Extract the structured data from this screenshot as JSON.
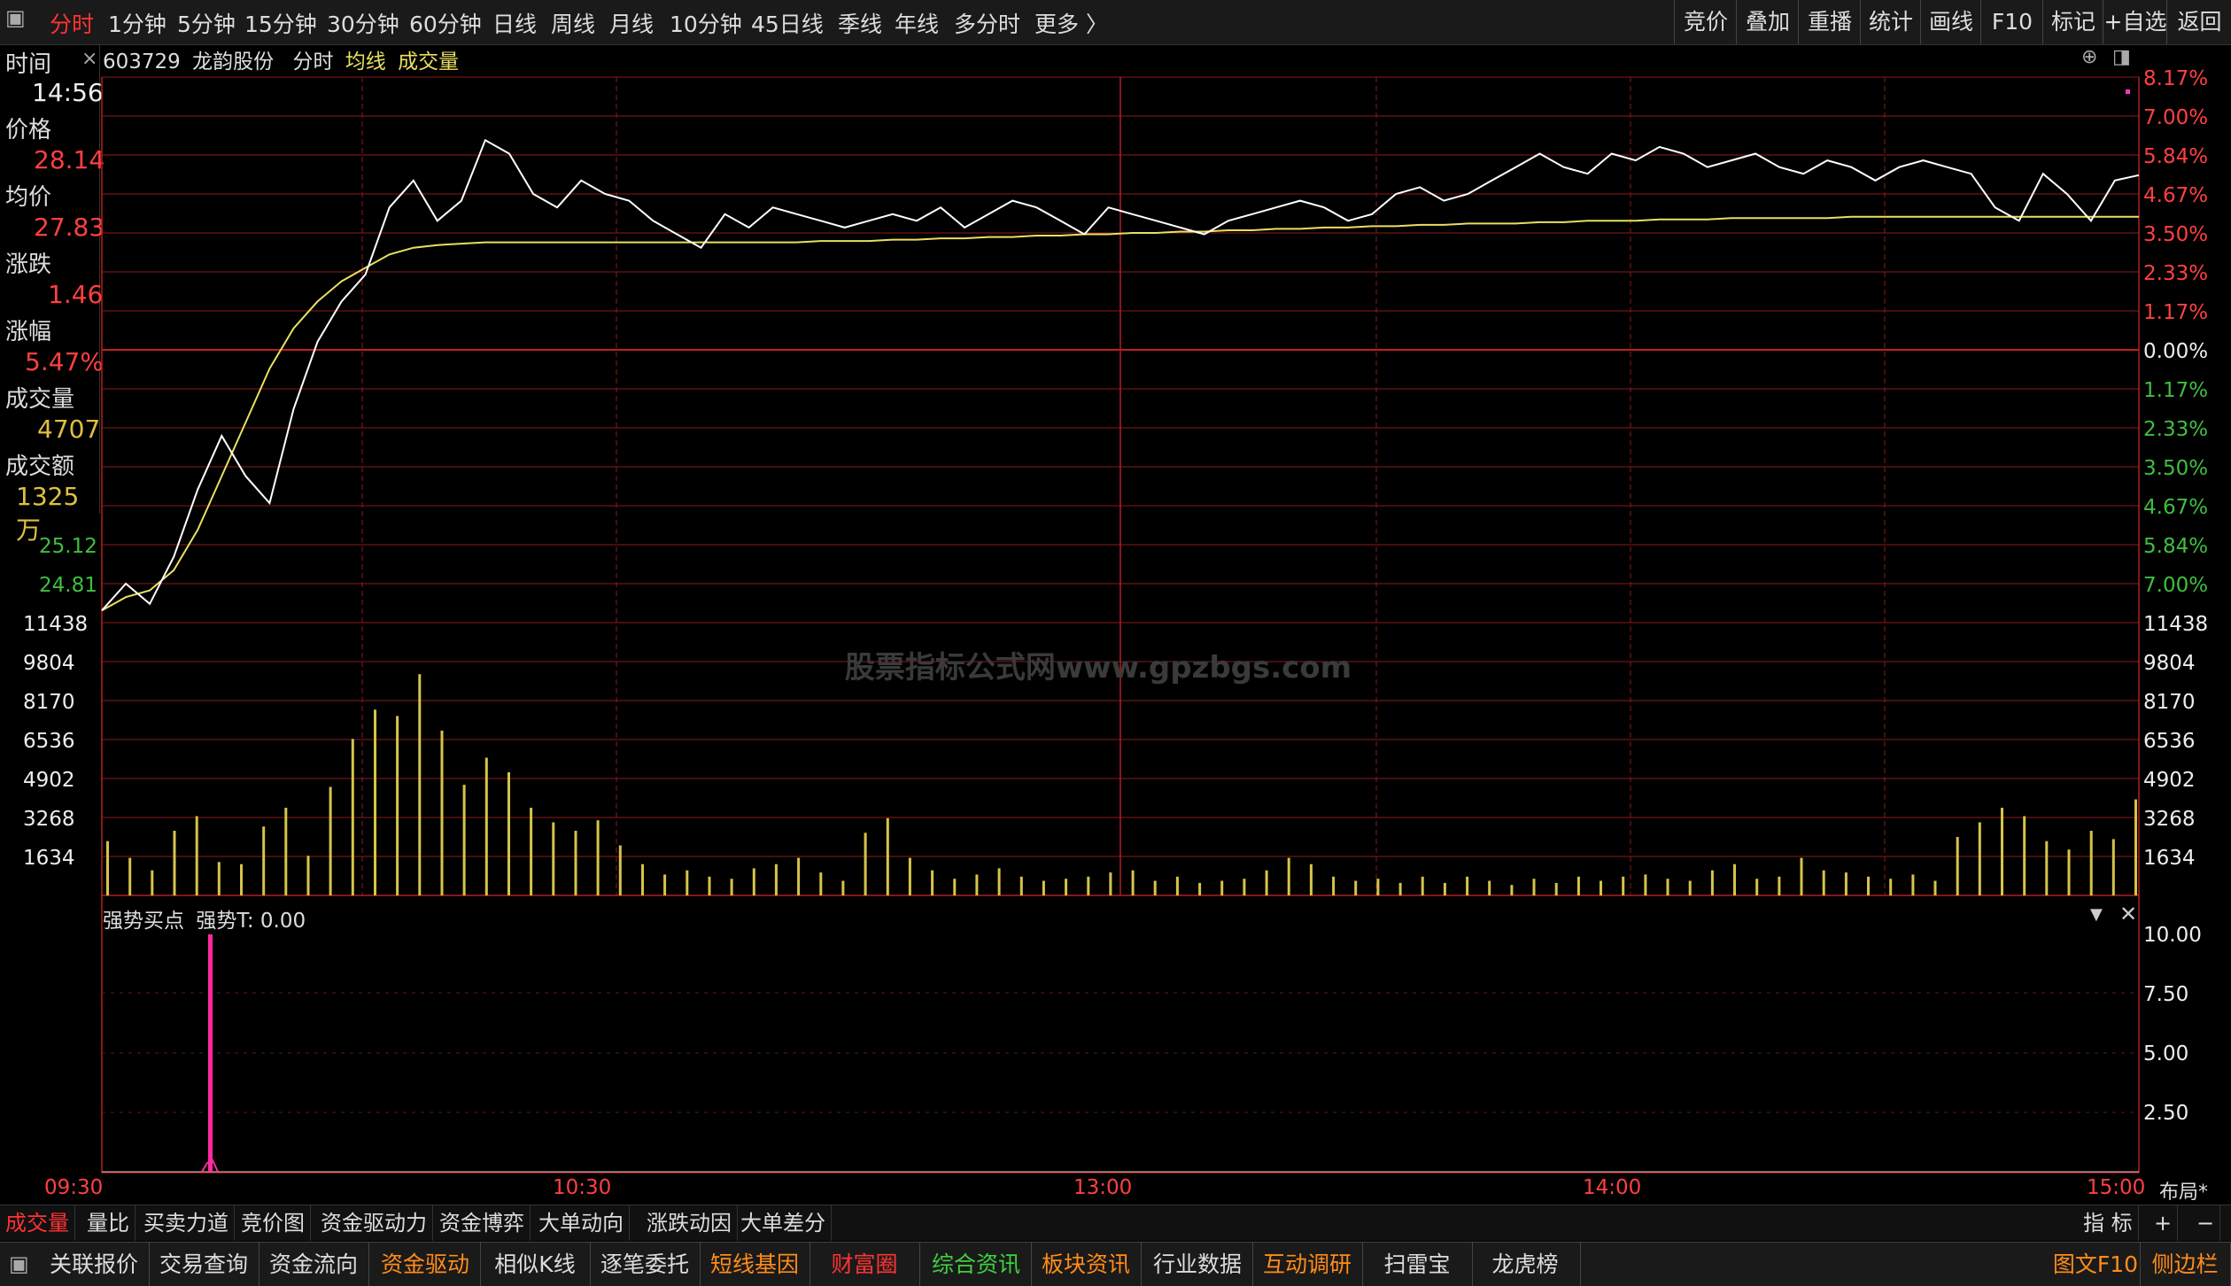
{
  "topbar": {
    "periods": [
      "分时",
      "1分钟",
      "5分钟",
      "15分钟",
      "30分钟",
      "60分钟",
      "日线",
      "周线",
      "月线",
      "10分钟",
      "45日线",
      "季线",
      "年线",
      "多分时",
      "更多 〉"
    ],
    "active_period": "分时",
    "right_buttons": [
      "竞价",
      "叠加",
      "重播",
      "统计",
      "画线",
      "F10",
      "标记",
      "+自选",
      "返回"
    ]
  },
  "chart_header": {
    "code": "603729",
    "name": "龙韵股份",
    "mode": "分时",
    "avg_label": "均线",
    "vol_label": "成交量"
  },
  "info_panel": {
    "time_label": "时间",
    "time_value": "14:56",
    "close_x": "×",
    "price_label": "价格",
    "price_value": "28.14",
    "avg_label": "均价",
    "avg_value": "27.83",
    "change_label": "涨跌",
    "change_value": "1.46",
    "pct_label": "涨幅",
    "pct_value": "5.47%",
    "vol_label": "成交量",
    "vol_value": "4707",
    "amount_label": "成交额",
    "amount_value": "1325万"
  },
  "price_axis_left": [
    "25.12",
    "24.81"
  ],
  "price_axis_right_up": [
    "8.17%",
    "7.00%",
    "5.84%",
    "4.67%",
    "3.50%",
    "2.33%",
    "1.17%",
    "0.00%"
  ],
  "price_axis_right_down": [
    "1.17%",
    "2.33%",
    "3.50%",
    "4.67%",
    "5.84%",
    "7.00%"
  ],
  "volume_axis": [
    "11438",
    "9804",
    "8170",
    "6536",
    "4902",
    "3268",
    "1634"
  ],
  "indicator": {
    "title": "强势买点",
    "value_label": "强势T: 0.00",
    "axis": [
      "10.00",
      "7.50",
      "5.00",
      "2.50"
    ]
  },
  "watermark": "股票指标公式网www.gpzbgs.com",
  "time_axis": [
    "09:30",
    "10:30",
    "13:00",
    "14:00",
    "15:00"
  ],
  "layout_btn": "布局*",
  "bottom_tabs": [
    "成交量",
    "量比",
    "买卖力道",
    "竞价图",
    "资金驱动力",
    "资金博弈",
    "大单动向",
    "涨跌动因",
    "大单差分"
  ],
  "bottom_tabs_right": [
    "指 标",
    "+",
    "−"
  ],
  "bottom_bar": [
    "关联报价",
    "交易查询",
    "资金流向",
    "资金驱动",
    "相似K线",
    "逐笔委托",
    "短线基因",
    "财富圈",
    "综合资讯",
    "板块资讯",
    "行业数据",
    "互动调研",
    "扫雷宝",
    "龙虎榜"
  ],
  "bottom_bar_right": [
    "图文F10",
    "侧边栏"
  ],
  "colors": {
    "grid": "#8b1a1a",
    "price_line": "#ffffff",
    "avg_line": "#e8e060",
    "volume": "#d6c44a",
    "signal": "#ff2aa0"
  },
  "chart_data": {
    "type": "line",
    "price_range": [
      24.81,
      28.87
    ],
    "pre_close": 26.68,
    "volume_range": [
      0,
      13072
    ],
    "series": [
      {
        "name": "价格",
        "values": [
          24.9,
          25.1,
          24.95,
          25.3,
          25.8,
          26.2,
          25.9,
          25.7,
          26.4,
          26.9,
          27.2,
          27.4,
          27.9,
          28.1,
          27.8,
          27.95,
          28.4,
          28.3,
          28.0,
          27.9,
          28.1,
          28.0,
          27.95,
          27.8,
          27.7,
          27.6,
          27.85,
          27.75,
          27.9,
          27.85,
          27.8,
          27.75,
          27.8,
          27.85,
          27.8,
          27.9,
          27.75,
          27.85,
          27.95,
          27.9,
          27.8,
          27.7,
          27.9,
          27.85,
          27.8,
          27.75,
          27.7,
          27.8,
          27.85,
          27.9,
          27.95,
          27.9,
          27.8,
          27.85,
          28.0,
          28.05,
          27.95,
          28.0,
          28.1,
          28.2,
          28.3,
          28.2,
          28.15,
          28.3,
          28.25,
          28.35,
          28.3,
          28.2,
          28.25,
          28.3,
          28.2,
          28.15,
          28.25,
          28.2,
          28.1,
          28.2,
          28.25,
          28.2,
          28.15,
          27.9,
          27.8,
          28.15,
          28.0,
          27.8,
          28.1,
          28.14
        ]
      },
      {
        "name": "均价",
        "values": [
          24.9,
          25.0,
          25.05,
          25.2,
          25.5,
          25.9,
          26.3,
          26.7,
          27.0,
          27.2,
          27.35,
          27.45,
          27.55,
          27.6,
          27.62,
          27.63,
          27.64,
          27.64,
          27.64,
          27.64,
          27.64,
          27.64,
          27.64,
          27.64,
          27.64,
          27.64,
          27.64,
          27.64,
          27.64,
          27.64,
          27.65,
          27.65,
          27.65,
          27.66,
          27.66,
          27.67,
          27.67,
          27.68,
          27.68,
          27.69,
          27.69,
          27.7,
          27.7,
          27.71,
          27.71,
          27.72,
          27.72,
          27.73,
          27.73,
          27.74,
          27.74,
          27.75,
          27.75,
          27.76,
          27.76,
          27.77,
          27.77,
          27.78,
          27.78,
          27.78,
          27.79,
          27.79,
          27.8,
          27.8,
          27.8,
          27.81,
          27.81,
          27.81,
          27.82,
          27.82,
          27.82,
          27.82,
          27.82,
          27.83,
          27.83,
          27.83,
          27.83,
          27.83,
          27.83,
          27.83,
          27.83,
          27.83,
          27.83,
          27.83,
          27.83,
          27.83
        ]
      }
    ],
    "volume": [
      2600,
      1800,
      1200,
      3100,
      3800,
      1600,
      1500,
      3300,
      4200,
      1900,
      5200,
      7500,
      8900,
      8600,
      10600,
      7900,
      5300,
      6600,
      5900,
      4200,
      3500,
      3100,
      3600,
      2400,
      1500,
      1000,
      1200,
      900,
      800,
      1300,
      1500,
      1800,
      1100,
      700,
      3000,
      3700,
      1800,
      1200,
      800,
      1000,
      1300,
      900,
      700,
      800,
      900,
      1100,
      1200,
      700,
      900,
      600,
      700,
      800,
      1200,
      1800,
      1500,
      900,
      700,
      800,
      600,
      900,
      600,
      900,
      700,
      500,
      800,
      600,
      900,
      700,
      900,
      1000,
      800,
      700,
      1200,
      1500,
      800,
      900,
      1800,
      1200,
      1100,
      900,
      800,
      1000,
      700,
      2800,
      3500,
      4200,
      3800,
      2600,
      2200,
      3100,
      2700,
      4600
    ]
  }
}
